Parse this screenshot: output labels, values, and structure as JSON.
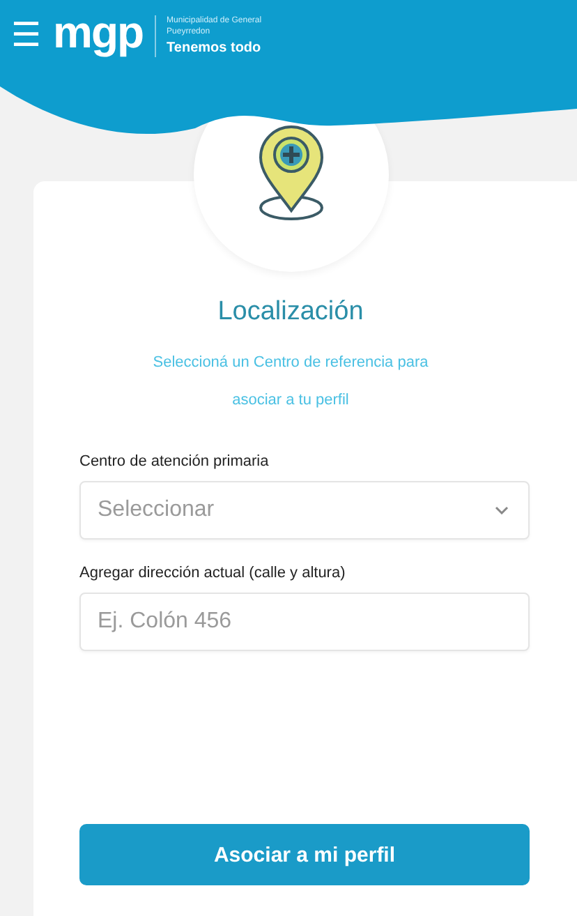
{
  "header": {
    "menu_icon": "☰",
    "logo": "mgp",
    "org_name": "Municipalidad de General Pueyrredon",
    "slogan": "Tenemos todo"
  },
  "card": {
    "title": "Localización",
    "description": "Seleccioná un Centro de referencia para asociar a tu perfil",
    "fields": [
      {
        "kind": "select",
        "label": "Centro de atención primaria",
        "placeholder": "Seleccionar"
      },
      {
        "kind": "text",
        "label": "Agregar dirección actual (calle y altura)",
        "placeholder": "Ej. Colón 456"
      }
    ],
    "button": "Asociar a mi perfil"
  }
}
